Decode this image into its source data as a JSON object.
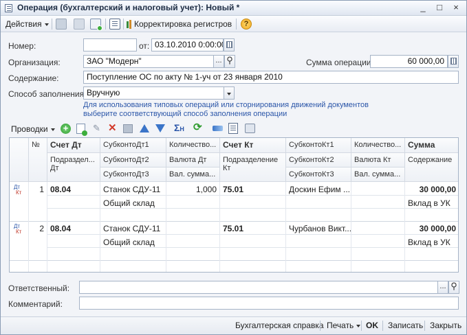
{
  "window": {
    "title": "Операция (бухгалтерский и налоговый учет): Новый *",
    "buttons": [
      "_",
      "□",
      "×"
    ]
  },
  "toolbar": {
    "actions_label": "Действия",
    "correction_label": "Корректировка регистров",
    "help_label": "?"
  },
  "form": {
    "number_label": "Номер:",
    "number_value": "",
    "from_label": "от:",
    "date_value": "03.10.2010  0:00:00",
    "org_label": "Организация:",
    "org_value": "ЗАО \"Модерн\"",
    "sum_label": "Сумма операции:",
    "sum_value": "60 000,00",
    "content_label": "Содержание:",
    "content_value": "Поступление ОС по акту № 1-уч от 23 января 2010",
    "fill_label": "Способ заполнения:",
    "fill_value": "Вручную",
    "hint_line1": "Для использования типовых операций или сторнирования движений документов",
    "hint_line2": "выберите соответствующий способ заполнения операции",
    "select_btn": "...",
    "search_btn": "⚲"
  },
  "grid_toolbar": {
    "entries_label": "Проводки"
  },
  "grid": {
    "headers": {
      "num": "№",
      "acc_dt": "Счет Дт",
      "sub_dt1": "СубконтоДт1",
      "qty_dt": "Количество...",
      "acc_kt": "Счет Кт",
      "sub_kt1": "СубконтоКт1",
      "qty_kt": "Количество...",
      "sum": "Сумма",
      "dept_dt": "Подраздел... Дт",
      "sub_dt2": "СубконтоДт2",
      "cur_dt": "Валюта Дт",
      "dept_kt": "Подразделение Кт",
      "sub_kt2": "СубконтоКт2",
      "cur_kt": "Валюта Кт",
      "content": "Содержание",
      "sub_dt3": "СубконтоДт3",
      "cur_sum_dt": "Вал. сумма...",
      "sub_kt3": "СубконтоКт3",
      "cur_sum_kt": "Вал. сумма..."
    },
    "rows": [
      {
        "icon_dt": "Дт",
        "icon_kt": "Кт",
        "num": "1",
        "acc_dt": "08.04",
        "sub_dt1": "Станок СДУ-11",
        "qty_dt": "1,000",
        "acc_kt": "75.01",
        "sub_kt1": "Доскин Ефим ...",
        "sum": "30 000,00",
        "sub_dt2": "Общий склад",
        "content": "Вклад в УК"
      },
      {
        "icon_dt": "Дт",
        "icon_kt": "Кт",
        "num": "2",
        "acc_dt": "08.04",
        "sub_dt1": "Станок СДУ-11",
        "qty_dt": "",
        "acc_kt": "75.01",
        "sub_kt1": "Чурбанов Викт...",
        "sum": "30 000,00",
        "sub_dt2": "Общий склад",
        "content": "Вклад в УК"
      }
    ]
  },
  "footer": {
    "responsible_label": "Ответственный:",
    "responsible_value": "",
    "comment_label": "Комментарий:",
    "comment_value": ""
  },
  "bottom": {
    "report_label": "Бухгалтерская справка",
    "print_label": "Печать",
    "ok_label": "OK",
    "save_label": "Записать",
    "close_label": "Закрыть"
  }
}
